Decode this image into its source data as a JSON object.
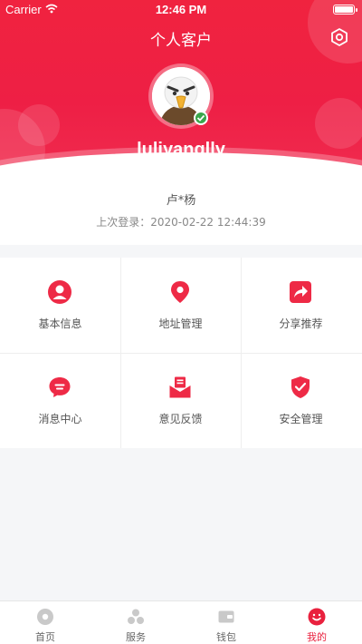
{
  "status_bar": {
    "carrier": "Carrier",
    "time": "12:46 PM"
  },
  "header": {
    "title": "个人客户",
    "username": "luliyanglly"
  },
  "profile": {
    "name": "卢*杨",
    "last_login": "上次登录：2020-02-22 12:44:39"
  },
  "grid": [
    {
      "label": "基本信息",
      "icon": "user-icon"
    },
    {
      "label": "地址管理",
      "icon": "location-pin-icon"
    },
    {
      "label": "分享推荐",
      "icon": "share-icon"
    },
    {
      "label": "消息中心",
      "icon": "message-icon"
    },
    {
      "label": "意见反馈",
      "icon": "feedback-icon"
    },
    {
      "label": "安全管理",
      "icon": "shield-icon"
    }
  ],
  "tabbar": [
    {
      "label": "首页",
      "icon": "home-icon"
    },
    {
      "label": "服务",
      "icon": "services-icon"
    },
    {
      "label": "钱包",
      "icon": "wallet-icon"
    },
    {
      "label": "我的",
      "icon": "smile-icon",
      "active": true
    }
  ],
  "colors": {
    "primary": "#f0233f",
    "accent_red": "#e9213e",
    "verified_green": "#3aa64b"
  }
}
